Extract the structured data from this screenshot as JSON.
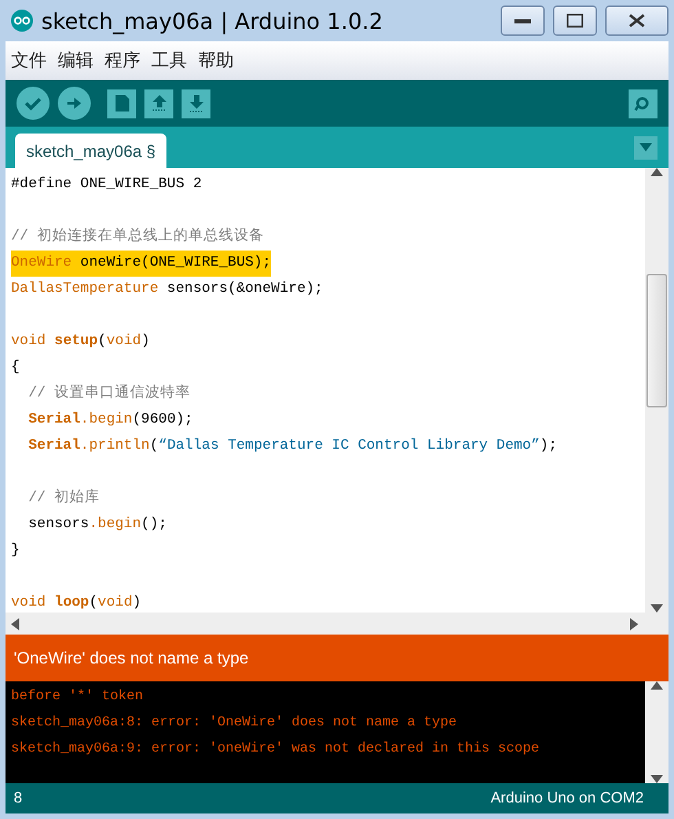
{
  "window": {
    "title": "sketch_may06a | Arduino 1.0.2"
  },
  "menu": [
    "文件",
    "编辑",
    "程序",
    "工具",
    "帮助"
  ],
  "toolbar": [
    {
      "kind": "verify"
    },
    {
      "kind": "upload"
    },
    {
      "kind": "new"
    },
    {
      "kind": "open"
    },
    {
      "kind": "save"
    }
  ],
  "tabs": [
    {
      "label": "sketch_may06a §",
      "selected": true
    }
  ],
  "editor": {
    "lines": [
      {
        "kind": "code",
        "selected": false,
        "tokens": [
          {
            "kind": "plain",
            "text": "#define ONE_WIRE_BUS 2"
          }
        ]
      },
      {
        "kind": "blank"
      },
      {
        "kind": "code",
        "selected": false,
        "tokens": [
          {
            "kind": "comment",
            "text": "// 初始连接在单总线上的单总线设备"
          }
        ]
      },
      {
        "kind": "code",
        "selected": true,
        "tokens": [
          {
            "kind": "type",
            "text": "OneWire"
          },
          {
            "kind": "plain",
            "text": " oneWire(ONE_WIRE_BUS);"
          }
        ]
      },
      {
        "kind": "code",
        "selected": false,
        "tokens": [
          {
            "kind": "type",
            "text": "DallasTemperature"
          },
          {
            "kind": "plain",
            "text": " sensors(&oneWire);"
          }
        ]
      },
      {
        "kind": "blank"
      },
      {
        "kind": "code",
        "selected": false,
        "tokens": [
          {
            "kind": "type",
            "text": "void "
          },
          {
            "kind": "bold",
            "text": "setup"
          },
          {
            "kind": "plain",
            "text": "("
          },
          {
            "kind": "type",
            "text": "void"
          },
          {
            "kind": "plain",
            "text": ")"
          }
        ]
      },
      {
        "kind": "code",
        "selected": false,
        "tokens": [
          {
            "kind": "plain",
            "text": "{"
          }
        ]
      },
      {
        "kind": "code",
        "selected": false,
        "tokens": [
          {
            "kind": "comment",
            "text": "  // 设置串口通信波特率"
          }
        ]
      },
      {
        "kind": "code",
        "selected": false,
        "tokens": [
          {
            "kind": "bold",
            "text": "  Serial"
          },
          {
            "kind": "type",
            "text": ".begin"
          },
          {
            "kind": "plain",
            "text": "(9600);"
          }
        ]
      },
      {
        "kind": "code",
        "selected": false,
        "tokens": [
          {
            "kind": "bold",
            "text": "  Serial"
          },
          {
            "kind": "type",
            "text": ".println"
          },
          {
            "kind": "plain",
            "text": "("
          },
          {
            "kind": "string",
            "text": "“Dallas Temperature IC Control Library Demo”"
          },
          {
            "kind": "plain",
            "text": ");"
          }
        ]
      },
      {
        "kind": "blank"
      },
      {
        "kind": "code",
        "selected": false,
        "tokens": [
          {
            "kind": "comment",
            "text": "  // 初始库"
          }
        ]
      },
      {
        "kind": "code",
        "selected": false,
        "tokens": [
          {
            "kind": "plain",
            "text": "  sensors"
          },
          {
            "kind": "type",
            "text": ".begin"
          },
          {
            "kind": "plain",
            "text": "();"
          }
        ]
      },
      {
        "kind": "code",
        "selected": false,
        "tokens": [
          {
            "kind": "plain",
            "text": "}"
          }
        ]
      },
      {
        "kind": "blank"
      },
      {
        "kind": "code",
        "selected": false,
        "tokens": [
          {
            "kind": "type",
            "text": "void "
          },
          {
            "kind": "bold",
            "text": "loop"
          },
          {
            "kind": "plain",
            "text": "("
          },
          {
            "kind": "type",
            "text": "void"
          },
          {
            "kind": "plain",
            "text": ")"
          }
        ]
      }
    ]
  },
  "message": "'OneWire' does not name a type",
  "console": [
    "before '*' token",
    "sketch_may06a:8: error: 'OneWire' does not name a type",
    "sketch_may06a:9: error: 'oneWire' was not declared in this scope"
  ],
  "status_bar": {
    "line": "8",
    "board": "Arduino Uno on COM2"
  }
}
